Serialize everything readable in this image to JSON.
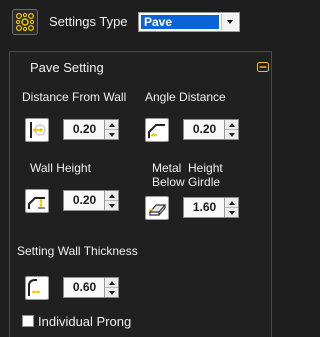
{
  "header": {
    "label": "Settings Type",
    "selected": "Pave",
    "icon": "pave-pattern-icon"
  },
  "panel": {
    "title": "Pave Setting",
    "collapse_icon": "collapse-icon"
  },
  "fields": {
    "distance_from_wall": {
      "label": "Distance From Wall",
      "value": "0.20",
      "icon": "distance-wall-icon"
    },
    "angle_distance": {
      "label": "Angle Distance",
      "value": "0.20",
      "icon": "angle-distance-icon"
    },
    "wall_height": {
      "label": "Wall Height",
      "value": "0.20",
      "icon": "wall-height-icon"
    },
    "metal_height": {
      "label_line1": "Metal  Height",
      "label_line2": "Below Girdle",
      "value": "1.60",
      "icon": "metal-height-icon"
    },
    "wall_thickness": {
      "label": "Setting Wall Thickness",
      "value": "0.60",
      "icon": "wall-thickness-icon"
    }
  },
  "individual_prong": {
    "label": "Individual Prong",
    "checked": false
  },
  "colors": {
    "background": "#1e1e1e",
    "accent_yellow": "#f4c400",
    "selection_blue": "#0a64d8"
  }
}
